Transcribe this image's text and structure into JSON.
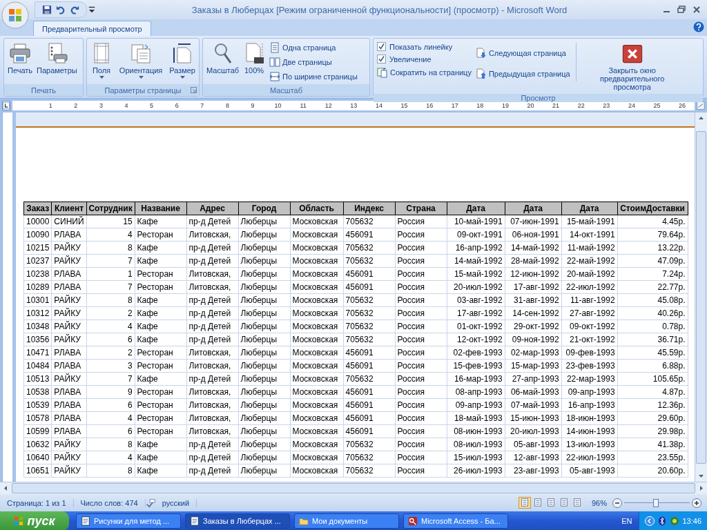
{
  "window": {
    "title": "Заказы в Люберцах [Режим ограниченной функциональности] (просмотр) - Microsoft Word"
  },
  "tabs": [
    {
      "label": "Предварительный просмотр",
      "selected": true
    }
  ],
  "ribbon": {
    "print": {
      "title": "Печать",
      "buttons": [
        "Печать",
        "Параметры"
      ]
    },
    "page_setup": {
      "title": "Параметры страницы",
      "buttons": [
        "Поля",
        "Ориентация",
        "Размер"
      ]
    },
    "zoom": {
      "title": "Масштаб",
      "large_buttons": [
        "Масштаб",
        "100%"
      ],
      "small_buttons": [
        "Одна страница",
        "Две страницы",
        "По ширине страницы"
      ]
    },
    "preview": {
      "title": "Просмотр",
      "options": [
        {
          "label": "Показать линейку",
          "checked": true
        },
        {
          "label": "Увеличение",
          "checked": true
        }
      ],
      "shrink_button": "Сократить на страницу",
      "nav_buttons": [
        "Следующая страница",
        "Предыдущая страница"
      ],
      "close_button": "Закрыть окно предварительного просмотра"
    }
  },
  "ruler": {
    "numbers": [
      "1",
      "2",
      "3",
      "4",
      "5",
      "6",
      "7",
      "8",
      "9",
      "10",
      "11",
      "12",
      "13",
      "14",
      "15",
      "16",
      "17",
      "18",
      "19",
      "20",
      "21",
      "22",
      "23",
      "24",
      "25",
      "26"
    ]
  },
  "table": {
    "columns": [
      {
        "label": "Заказ",
        "kind": "text"
      },
      {
        "label": "Клиент",
        "kind": "text"
      },
      {
        "label": "Сотрудник",
        "kind": "number"
      },
      {
        "label": "Название",
        "kind": "text"
      },
      {
        "label": "Адрес",
        "kind": "text"
      },
      {
        "label": "Город",
        "kind": "text"
      },
      {
        "label": "Область",
        "kind": "text"
      },
      {
        "label": "Индекс",
        "kind": "text"
      },
      {
        "label": "Страна",
        "kind": "text"
      },
      {
        "label": "Дата",
        "kind": "number"
      },
      {
        "label": "Дата",
        "kind": "number"
      },
      {
        "label": "Дата",
        "kind": "number"
      },
      {
        "label": "СтоимДоставки",
        "kind": "number"
      }
    ],
    "rows": [
      [
        "10000",
        "СИНИЙ",
        "15",
        "Кафе",
        "пр-д Детей",
        "Люберцы",
        "Московская",
        "705632",
        "Россия",
        "10-май-1991",
        "07-июн-1991",
        "15-май-1991",
        "4.45р."
      ],
      [
        "10090",
        "РЛАВА",
        "4",
        "Ресторан",
        "Литовская,",
        "Люберцы",
        "Московская",
        "456091",
        "Россия",
        "09-окт-1991",
        "06-ноя-1991",
        "14-окт-1991",
        "79.64р."
      ],
      [
        "10215",
        "РАЙКУ",
        "8",
        "Кафе",
        "пр-д Детей",
        "Люберцы",
        "Московская",
        "705632",
        "Россия",
        "16-апр-1992",
        "14-май-1992",
        "11-май-1992",
        "13.22р."
      ],
      [
        "10237",
        "РАЙКУ",
        "7",
        "Кафе",
        "пр-д Детей",
        "Люберцы",
        "Московская",
        "705632",
        "Россия",
        "14-май-1992",
        "28-май-1992",
        "22-май-1992",
        "47.09р."
      ],
      [
        "10238",
        "РЛАВА",
        "1",
        "Ресторан",
        "Литовская,",
        "Люберцы",
        "Московская",
        "456091",
        "Россия",
        "15-май-1992",
        "12-июн-1992",
        "20-май-1992",
        "7.24р."
      ],
      [
        "10289",
        "РЛАВА",
        "7",
        "Ресторан",
        "Литовская,",
        "Люберцы",
        "Московская",
        "456091",
        "Россия",
        "20-июл-1992",
        "17-авг-1992",
        "22-июл-1992",
        "22.77р."
      ],
      [
        "10301",
        "РАЙКУ",
        "8",
        "Кафе",
        "пр-д Детей",
        "Люберцы",
        "Московская",
        "705632",
        "Россия",
        "03-авг-1992",
        "31-авг-1992",
        "11-авг-1992",
        "45.08р."
      ],
      [
        "10312",
        "РАЙКУ",
        "2",
        "Кафе",
        "пр-д Детей",
        "Люберцы",
        "Московская",
        "705632",
        "Россия",
        "17-авг-1992",
        "14-сен-1992",
        "27-авг-1992",
        "40.26р."
      ],
      [
        "10348",
        "РАЙКУ",
        "4",
        "Кафе",
        "пр-д Детей",
        "Люберцы",
        "Московская",
        "705632",
        "Россия",
        "01-окт-1992",
        "29-окт-1992",
        "09-окт-1992",
        "0.78р."
      ],
      [
        "10356",
        "РАЙКУ",
        "6",
        "Кафе",
        "пр-д Детей",
        "Люберцы",
        "Московская",
        "705632",
        "Россия",
        "12-окт-1992",
        "09-ноя-1992",
        "21-окт-1992",
        "36.71р."
      ],
      [
        "10471",
        "РЛАВА",
        "2",
        "Ресторан",
        "Литовская,",
        "Люберцы",
        "Московская",
        "456091",
        "Россия",
        "02-фев-1993",
        "02-мар-1993",
        "09-фев-1993",
        "45.59р."
      ],
      [
        "10484",
        "РЛАВА",
        "3",
        "Ресторан",
        "Литовская,",
        "Люберцы",
        "Московская",
        "456091",
        "Россия",
        "15-фев-1993",
        "15-мар-1993",
        "23-фев-1993",
        "6.88р."
      ],
      [
        "10513",
        "РАЙКУ",
        "7",
        "Кафе",
        "пр-д Детей",
        "Люберцы",
        "Московская",
        "705632",
        "Россия",
        "16-мар-1993",
        "27-апр-1993",
        "22-мар-1993",
        "105.65р."
      ],
      [
        "10538",
        "РЛАВА",
        "9",
        "Ресторан",
        "Литовская,",
        "Люберцы",
        "Московская",
        "456091",
        "Россия",
        "08-апр-1993",
        "06-май-1993",
        "09-апр-1993",
        "4.87р."
      ],
      [
        "10539",
        "РЛАВА",
        "6",
        "Ресторан",
        "Литовская,",
        "Люберцы",
        "Московская",
        "456091",
        "Россия",
        "09-апр-1993",
        "07-май-1993",
        "16-апр-1993",
        "12.36р."
      ],
      [
        "10578",
        "РЛАВА",
        "4",
        "Ресторан",
        "Литовская,",
        "Люберцы",
        "Московская",
        "456091",
        "Россия",
        "18-май-1993",
        "15-июн-1993",
        "18-июн-1993",
        "29.60р."
      ],
      [
        "10599",
        "РЛАВА",
        "6",
        "Ресторан",
        "Литовская,",
        "Люберцы",
        "Московская",
        "456091",
        "Россия",
        "08-июн-1993",
        "20-июл-1993",
        "14-июн-1993",
        "29.98р."
      ],
      [
        "10632",
        "РАЙКУ",
        "8",
        "Кафе",
        "пр-д Детей",
        "Люберцы",
        "Московская",
        "705632",
        "Россия",
        "08-июл-1993",
        "05-авг-1993",
        "13-июл-1993",
        "41.38р."
      ],
      [
        "10640",
        "РАЙКУ",
        "4",
        "Кафе",
        "пр-д Детей",
        "Люберцы",
        "Московская",
        "705632",
        "Россия",
        "15-июл-1993",
        "12-авг-1993",
        "22-июл-1993",
        "23.55р."
      ],
      [
        "10651",
        "РАЙКУ",
        "8",
        "Кафе",
        "пр-д Детей",
        "Люберцы",
        "Московская",
        "705632",
        "Россия",
        "26-июл-1993",
        "23-авг-1993",
        "05-авг-1993",
        "20.60р."
      ]
    ]
  },
  "status_bar": {
    "page": "Страница: 1 из 1",
    "words": "Число слов: 474",
    "language": "русский",
    "views": [
      {
        "selected": true
      },
      {
        "selected": false
      },
      {
        "selected": false
      },
      {
        "selected": false
      },
      {
        "selected": false
      }
    ],
    "zoom": "96%",
    "zoom_slider": {
      "level": 0.48
    }
  },
  "taskbar": {
    "start": "пуск",
    "tasks": [
      {
        "label": "Рисунки для метод ...",
        "selected": false
      },
      {
        "label": "Заказы в Люберцах ...",
        "selected": true
      },
      {
        "label": "Мои документы",
        "selected": false
      },
      {
        "label": "Microsoft Access - Ба...",
        "selected": false
      }
    ],
    "language": "EN",
    "time": "13:46"
  }
}
